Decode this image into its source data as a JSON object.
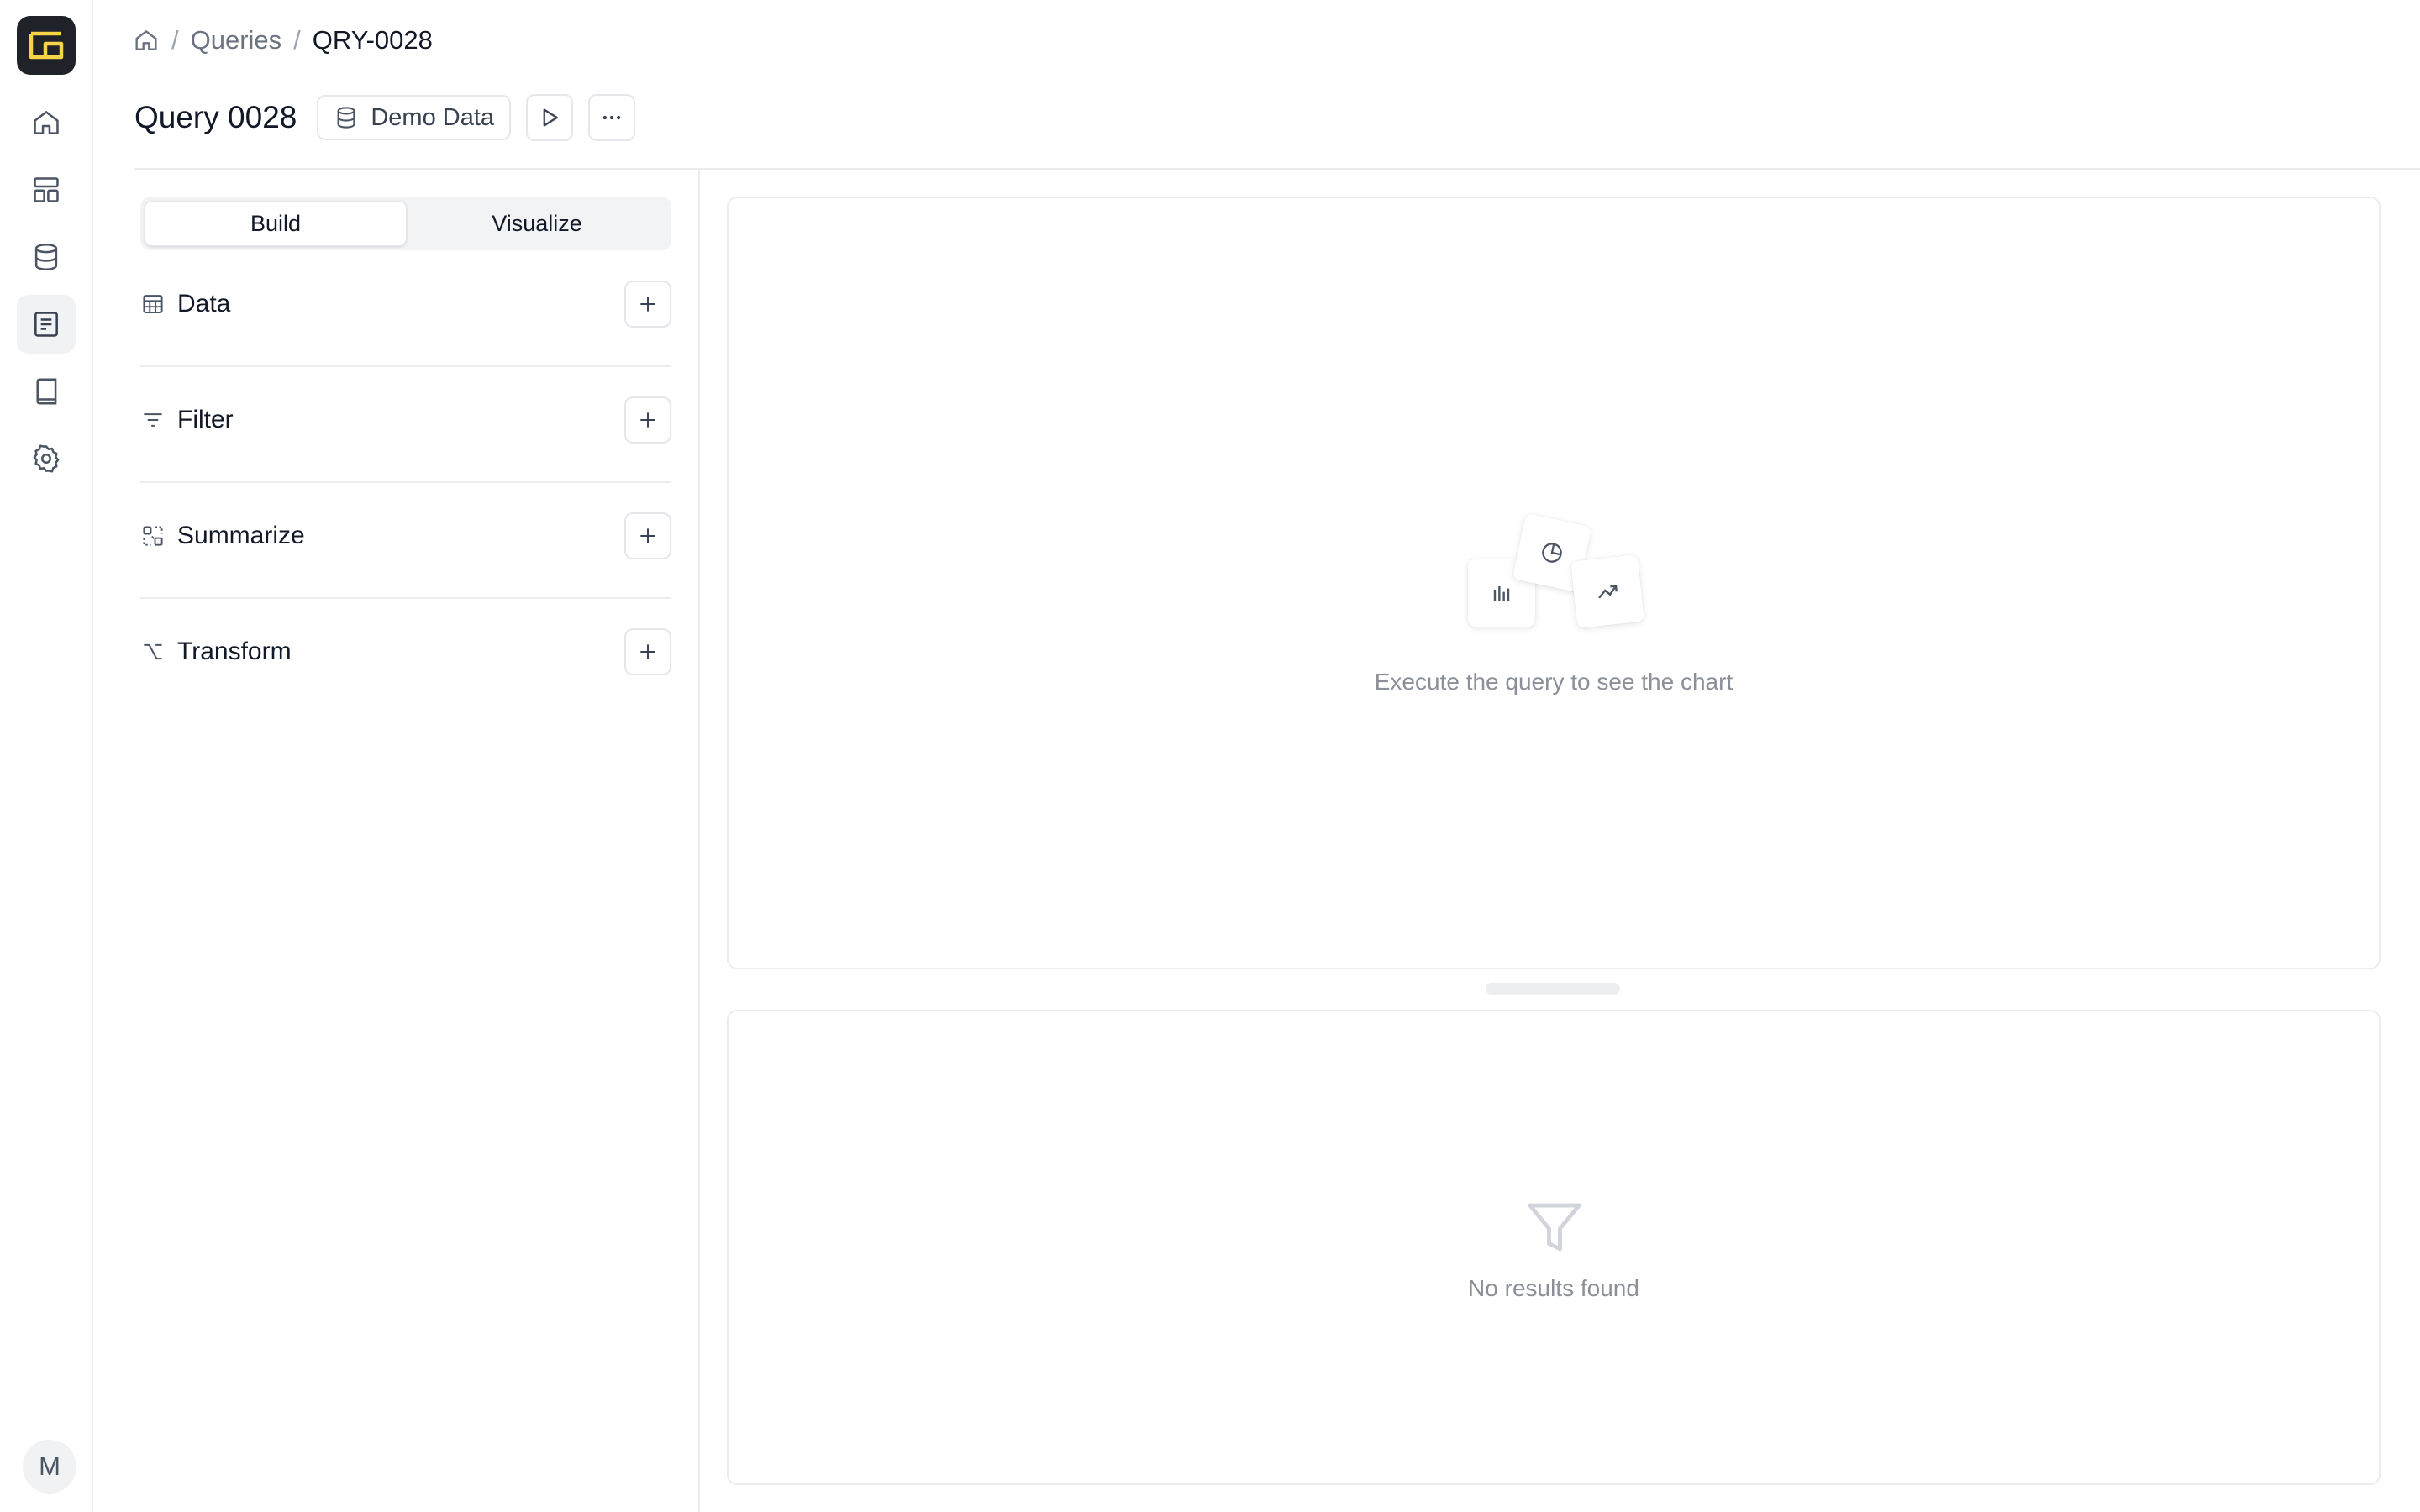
{
  "rail": {
    "logo_icon": "logo-icon",
    "nav": [
      "home-icon",
      "dashboard-icon",
      "database-icon",
      "queries-icon",
      "notebook-icon",
      "settings-icon"
    ],
    "active_index": 3,
    "avatar_initial": "M"
  },
  "breadcrumb": {
    "items": [
      "Queries"
    ],
    "current": "QRY-0028",
    "separator": "/"
  },
  "header": {
    "title": "Query 0028",
    "data_source": "Demo Data"
  },
  "builder": {
    "tabs": [
      {
        "label": "Build",
        "active": true
      },
      {
        "label": "Visualize",
        "active": false
      }
    ],
    "sections": [
      {
        "label": "Data",
        "icon": "table-icon"
      },
      {
        "label": "Filter",
        "icon": "filter-lines-icon"
      },
      {
        "label": "Summarize",
        "icon": "summarize-icon"
      },
      {
        "label": "Transform",
        "icon": "transform-icon"
      }
    ]
  },
  "chart_panel": {
    "empty_message": "Execute the query to see the chart"
  },
  "results_panel": {
    "empty_message": "No results found"
  },
  "colors": {
    "logo_bg": "#1f2228",
    "logo_accent": "#f5d547",
    "border": "#ececec",
    "muted_text": "#8a8f98"
  }
}
